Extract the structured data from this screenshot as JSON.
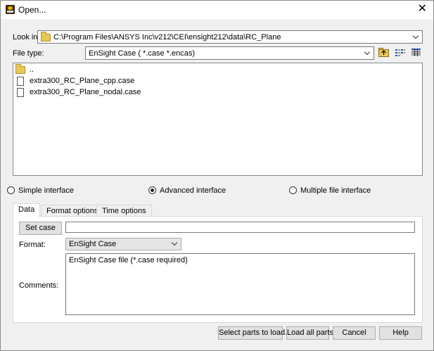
{
  "window": {
    "title": "Open...",
    "close_glyph": "✕"
  },
  "look_in": {
    "label": "Look in:",
    "path": "C:\\Program Files\\ANSYS Inc\\v212\\CEI\\ensight212\\data\\RC_Plane"
  },
  "file_type": {
    "label": "File type:",
    "value": "EnSight Case ( *.case *.encas)"
  },
  "toolbar": {
    "icons": [
      "up-folder-icon",
      "list-view-icon",
      "detail-view-icon"
    ]
  },
  "files": [
    {
      "name": "..",
      "kind": "folder"
    },
    {
      "name": "extra300_RC_Plane_cpp.case",
      "kind": "file"
    },
    {
      "name": "extra300_RC_Plane_nodal.case",
      "kind": "file"
    }
  ],
  "interface_modes": [
    {
      "label": "Simple interface",
      "selected": false
    },
    {
      "label": "Advanced interface",
      "selected": true
    },
    {
      "label": "Multiple file interface",
      "selected": false
    }
  ],
  "tabs": [
    {
      "label": "Data",
      "active": true
    },
    {
      "label": "Format options",
      "active": false
    },
    {
      "label": "Time options",
      "active": false
    }
  ],
  "data_tab": {
    "set_case_label": "Set case",
    "case_value": "",
    "format_label": "Format:",
    "format_value": "EnSight Case",
    "comments_label": "Comments:",
    "comments_value": "EnSight Case file (*.case required)"
  },
  "buttons": {
    "select_parts": "Select parts to load...",
    "load_all": "Load all parts",
    "cancel": "Cancel",
    "help": "Help"
  }
}
